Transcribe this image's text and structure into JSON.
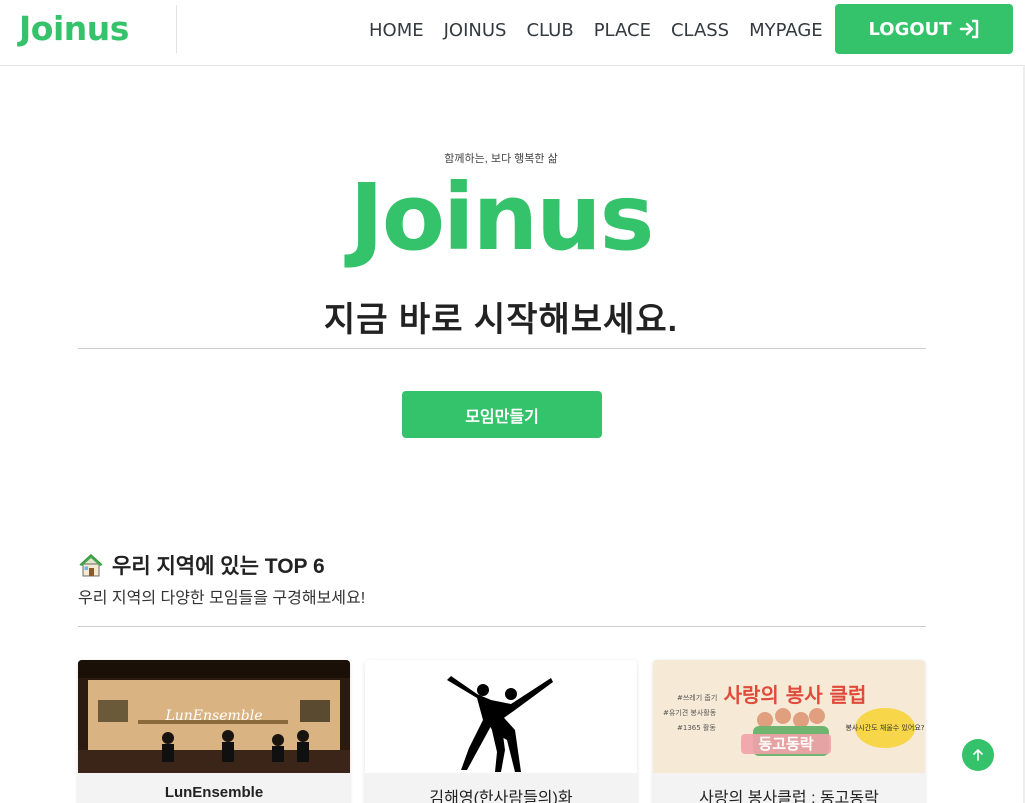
{
  "header": {
    "brand": "Joinus",
    "nav": [
      "HOME",
      "JOINUS",
      "CLUB",
      "PLACE",
      "CLASS",
      "MYPAGE"
    ],
    "logout_label": "LOGOUT"
  },
  "hero": {
    "subtitle": "함께하는, 보다 행복한 삶",
    "logo": "Joinus",
    "heading": "지금 바로 시작해보세요.",
    "create_button": "모임만들기"
  },
  "section": {
    "title": "우리 지역에 있는 TOP 6",
    "description": "우리 지역의 다양한 모임들을 구경해보세요!"
  },
  "cards": [
    {
      "title": "LunEnsemble",
      "image_text": "LunEnsemble"
    },
    {
      "title": "김해영(한사람들의)화"
    },
    {
      "title": "사랑의 봉사클럽 : 동고동락",
      "image_heading": "사랑의 봉사 클럽",
      "image_tags": [
        "#쓰레기 줍기",
        "#유기견 봉사활동",
        "#1365 활동"
      ],
      "image_banner": "동고동락",
      "image_bubble": "봉사시간도 채울수 있어요?"
    }
  ],
  "colors": {
    "accent": "#34c26a",
    "text": "#222222"
  }
}
